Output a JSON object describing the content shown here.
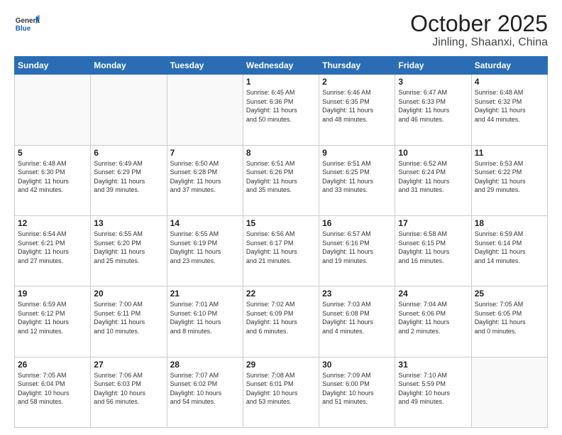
{
  "header": {
    "logo_general": "General",
    "logo_blue": "Blue",
    "month_title": "October 2025",
    "location": "Jinling, Shaanxi, China"
  },
  "weekdays": [
    "Sunday",
    "Monday",
    "Tuesday",
    "Wednesday",
    "Thursday",
    "Friday",
    "Saturday"
  ],
  "weeks": [
    [
      {
        "day": "",
        "info": ""
      },
      {
        "day": "",
        "info": ""
      },
      {
        "day": "",
        "info": ""
      },
      {
        "day": "1",
        "info": "Sunrise: 6:45 AM\nSunset: 6:36 PM\nDaylight: 11 hours\nand 50 minutes."
      },
      {
        "day": "2",
        "info": "Sunrise: 6:46 AM\nSunset: 6:35 PM\nDaylight: 11 hours\nand 48 minutes."
      },
      {
        "day": "3",
        "info": "Sunrise: 6:47 AM\nSunset: 6:33 PM\nDaylight: 11 hours\nand 46 minutes."
      },
      {
        "day": "4",
        "info": "Sunrise: 6:48 AM\nSunset: 6:32 PM\nDaylight: 11 hours\nand 44 minutes."
      }
    ],
    [
      {
        "day": "5",
        "info": "Sunrise: 6:48 AM\nSunset: 6:30 PM\nDaylight: 11 hours\nand 42 minutes."
      },
      {
        "day": "6",
        "info": "Sunrise: 6:49 AM\nSunset: 6:29 PM\nDaylight: 11 hours\nand 39 minutes."
      },
      {
        "day": "7",
        "info": "Sunrise: 6:50 AM\nSunset: 6:28 PM\nDaylight: 11 hours\nand 37 minutes."
      },
      {
        "day": "8",
        "info": "Sunrise: 6:51 AM\nSunset: 6:26 PM\nDaylight: 11 hours\nand 35 minutes."
      },
      {
        "day": "9",
        "info": "Sunrise: 6:51 AM\nSunset: 6:25 PM\nDaylight: 11 hours\nand 33 minutes."
      },
      {
        "day": "10",
        "info": "Sunrise: 6:52 AM\nSunset: 6:24 PM\nDaylight: 11 hours\nand 31 minutes."
      },
      {
        "day": "11",
        "info": "Sunrise: 6:53 AM\nSunset: 6:22 PM\nDaylight: 11 hours\nand 29 minutes."
      }
    ],
    [
      {
        "day": "12",
        "info": "Sunrise: 6:54 AM\nSunset: 6:21 PM\nDaylight: 11 hours\nand 27 minutes."
      },
      {
        "day": "13",
        "info": "Sunrise: 6:55 AM\nSunset: 6:20 PM\nDaylight: 11 hours\nand 25 minutes."
      },
      {
        "day": "14",
        "info": "Sunrise: 6:55 AM\nSunset: 6:19 PM\nDaylight: 11 hours\nand 23 minutes."
      },
      {
        "day": "15",
        "info": "Sunrise: 6:56 AM\nSunset: 6:17 PM\nDaylight: 11 hours\nand 21 minutes."
      },
      {
        "day": "16",
        "info": "Sunrise: 6:57 AM\nSunset: 6:16 PM\nDaylight: 11 hours\nand 19 minutes."
      },
      {
        "day": "17",
        "info": "Sunrise: 6:58 AM\nSunset: 6:15 PM\nDaylight: 11 hours\nand 16 minutes."
      },
      {
        "day": "18",
        "info": "Sunrise: 6:59 AM\nSunset: 6:14 PM\nDaylight: 11 hours\nand 14 minutes."
      }
    ],
    [
      {
        "day": "19",
        "info": "Sunrise: 6:59 AM\nSunset: 6:12 PM\nDaylight: 11 hours\nand 12 minutes."
      },
      {
        "day": "20",
        "info": "Sunrise: 7:00 AM\nSunset: 6:11 PM\nDaylight: 11 hours\nand 10 minutes."
      },
      {
        "day": "21",
        "info": "Sunrise: 7:01 AM\nSunset: 6:10 PM\nDaylight: 11 hours\nand 8 minutes."
      },
      {
        "day": "22",
        "info": "Sunrise: 7:02 AM\nSunset: 6:09 PM\nDaylight: 11 hours\nand 6 minutes."
      },
      {
        "day": "23",
        "info": "Sunrise: 7:03 AM\nSunset: 6:08 PM\nDaylight: 11 hours\nand 4 minutes."
      },
      {
        "day": "24",
        "info": "Sunrise: 7:04 AM\nSunset: 6:06 PM\nDaylight: 11 hours\nand 2 minutes."
      },
      {
        "day": "25",
        "info": "Sunrise: 7:05 AM\nSunset: 6:05 PM\nDaylight: 11 hours\nand 0 minutes."
      }
    ],
    [
      {
        "day": "26",
        "info": "Sunrise: 7:05 AM\nSunset: 6:04 PM\nDaylight: 10 hours\nand 58 minutes."
      },
      {
        "day": "27",
        "info": "Sunrise: 7:06 AM\nSunset: 6:03 PM\nDaylight: 10 hours\nand 56 minutes."
      },
      {
        "day": "28",
        "info": "Sunrise: 7:07 AM\nSunset: 6:02 PM\nDaylight: 10 hours\nand 54 minutes."
      },
      {
        "day": "29",
        "info": "Sunrise: 7:08 AM\nSunset: 6:01 PM\nDaylight: 10 hours\nand 53 minutes."
      },
      {
        "day": "30",
        "info": "Sunrise: 7:09 AM\nSunset: 6:00 PM\nDaylight: 10 hours\nand 51 minutes."
      },
      {
        "day": "31",
        "info": "Sunrise: 7:10 AM\nSunset: 5:59 PM\nDaylight: 10 hours\nand 49 minutes."
      },
      {
        "day": "",
        "info": ""
      }
    ]
  ]
}
